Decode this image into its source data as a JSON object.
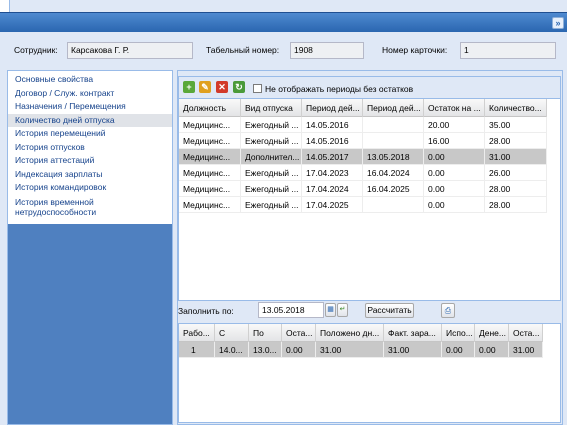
{
  "header": {
    "employee_label": "Сотрудник:",
    "employee_value": "Карсакова Г. Р.",
    "tabnum_label": "Табельный номер:",
    "tabnum_value": "1908",
    "card_label": "Номер карточки:",
    "card_value": "1"
  },
  "titlebar": {
    "collapse_icon": "double-chevron-right-icon",
    "collapse_glyph": "»"
  },
  "nav": {
    "items": [
      {
        "label": "Основные свойства"
      },
      {
        "label": "Договор / Служ. контракт"
      },
      {
        "label": "Назначения / Перемещения"
      },
      {
        "label": "Количество дней отпуска"
      },
      {
        "label": "История перемещений"
      },
      {
        "label": "История отпусков"
      },
      {
        "label": "История аттестаций"
      },
      {
        "label": "Индексация зарплаты"
      },
      {
        "label": "История командировок"
      },
      {
        "label": "История временной нетрудоспособности"
      }
    ],
    "selected_index": 3
  },
  "toolbar": {
    "add_icon": "add-icon",
    "edit_icon": "edit-icon",
    "delete_icon": "delete-icon",
    "refresh_icon": "refresh-icon",
    "hide_label": "Не отображать периоды без остатков"
  },
  "grid1": {
    "columns": [
      "Должность",
      "Вид отпуска",
      "Период дей...",
      "Период дей...",
      "Остаток на ...",
      "Количество..."
    ],
    "rows": [
      [
        "Медицинс...",
        "Ежегодный ...",
        "14.05.2016",
        "",
        "20.00",
        "35.00"
      ],
      [
        "Медицинс...",
        "Ежегодный ...",
        "14.05.2016",
        "",
        "16.00",
        "28.00"
      ],
      [
        "Медицинс...",
        "Дополнител...",
        "14.05.2017",
        "13.05.2018",
        "0.00",
        "31.00"
      ],
      [
        "Медицинс...",
        "Ежегодный ...",
        "17.04.2023",
        "16.04.2024",
        "0.00",
        "26.00"
      ],
      [
        "Медицинс...",
        "Ежегодный ...",
        "17.04.2024",
        "16.04.2025",
        "0.00",
        "28.00"
      ],
      [
        "Медицинс...",
        "Ежегодный ...",
        "17.04.2025",
        "",
        "0.00",
        "28.00"
      ]
    ],
    "selected_row": 2
  },
  "fill": {
    "label": "Заполнить по:",
    "date_value": "13.05.2018",
    "calc_label": "Рассчитать",
    "calendar_icon": "calendar-icon",
    "print_icon": "print-icon"
  },
  "grid2": {
    "columns": [
      "Рабо...",
      "С",
      "По",
      "Оста...",
      "Положено дн...",
      "Факт. зара...",
      "Испо...",
      "Дене...",
      "Оста..."
    ],
    "rows": [
      [
        "1",
        "14.0...",
        "13.0...",
        "0.00",
        "31.00",
        "31.00",
        "0.00",
        "0.00",
        "31.00"
      ]
    ]
  }
}
